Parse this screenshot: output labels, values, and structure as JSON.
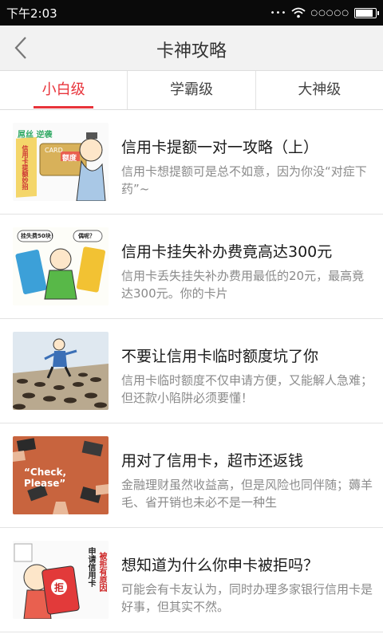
{
  "status": {
    "time": "下午2:03",
    "dots": "•••",
    "signal": "○○○○○"
  },
  "header": {
    "title": "卡神攻略"
  },
  "tabs": [
    {
      "label": "小白级",
      "active": true
    },
    {
      "label": "学霸级",
      "active": false
    },
    {
      "label": "大神级",
      "active": false
    }
  ],
  "articles": [
    {
      "title": "信用卡提额一对一攻略（上）",
      "desc": "信用卡想提额可是总不如意，因为你没“对症下药”~",
      "thumb_text": [
        "屌丝 逆袭",
        "CARD",
        "额度",
        "信用卡提额妙招"
      ]
    },
    {
      "title": "信用卡挂失补办费竟高达300元",
      "desc": "信用卡丢失挂失补办费用最低的20元，最高竟达300元。你的卡片",
      "thumb_text": [
        "挂失费50块！",
        "偶呢？"
      ]
    },
    {
      "title": "不要让信用卡临时额度坑了你",
      "desc": "信用卡临时额度不仅申请方便，又能解人急难；但还款小陷阱必须要懂！"
    },
    {
      "title": "用对了信用卡，超市还返钱",
      "desc": "金融理财虽然收益高，但是风险也同伴随；薅羊毛、省开销也未必不是一种生",
      "thumb_text": [
        "“Check, Please”"
      ]
    },
    {
      "title": "想知道为什么你申卡被拒吗？",
      "desc": "可能会有卡友认为，同时办理多家银行信用卡是好事，但其实不然。",
      "thumb_text": [
        "申请信用卡",
        "被拒有原因",
        "拒"
      ]
    }
  ],
  "colors": {
    "accent": "#e8343b",
    "status_bar": "#0a0a0a",
    "title_bar": "#f2f2f2"
  }
}
